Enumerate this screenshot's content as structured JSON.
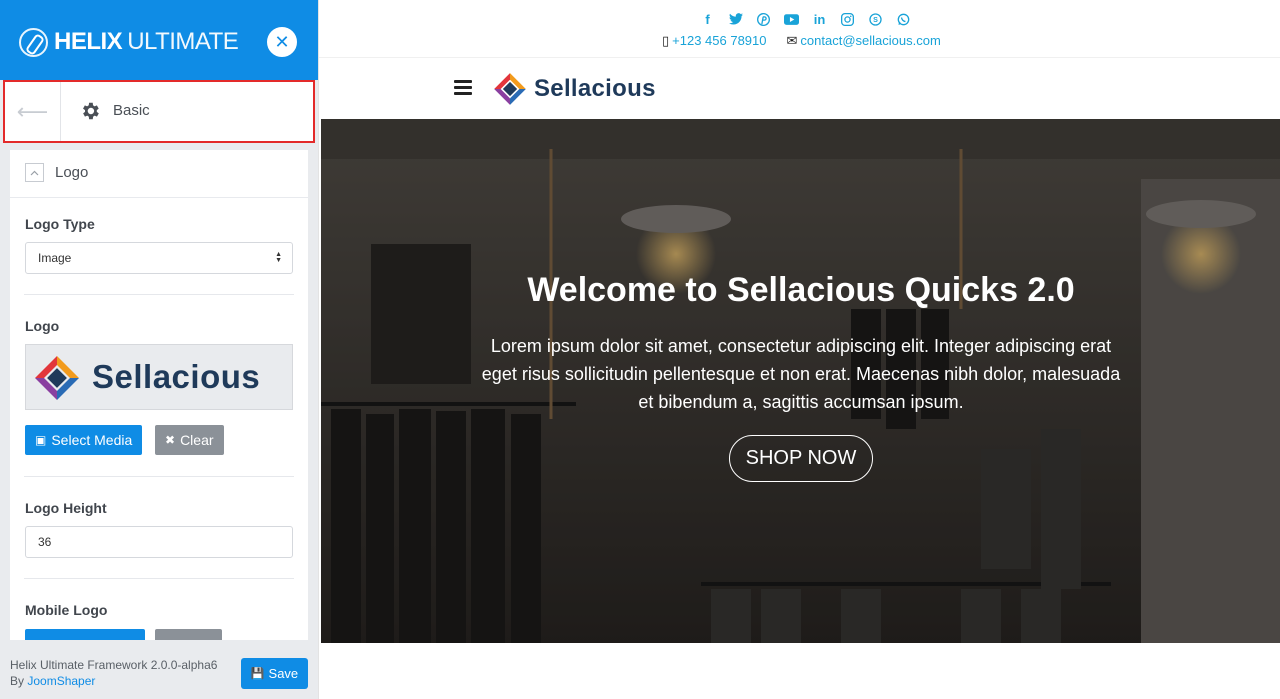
{
  "panel": {
    "brand_bold": "HELIX",
    "brand_light": "ULTIMATE",
    "section_title": "Basic",
    "group_title": "Logo",
    "fields": {
      "logo_type_label": "Logo Type",
      "logo_type_value": "Image",
      "logo_label": "Logo",
      "logo_preview_text": "Sellacious",
      "select_media": "Select Media",
      "clear": "Clear",
      "logo_height_label": "Logo Height",
      "logo_height_value": "36",
      "mobile_logo_label": "Mobile Logo"
    },
    "footer": {
      "version": "Helix Ultimate Framework 2.0.0-alpha6",
      "by": "By",
      "author": "JoomShaper",
      "save": "Save"
    }
  },
  "site": {
    "social_icons": [
      "facebook-icon",
      "twitter-icon",
      "pinterest-icon",
      "youtube-icon",
      "linkedin-icon",
      "instagram-icon",
      "skype-icon",
      "whatsapp-icon"
    ],
    "phone": "+123 456 78910",
    "email": "contact@sellacious.com",
    "logo_text": "Sellacious",
    "hero": {
      "title": "Welcome to Sellacious Quicks 2.0",
      "text": "Lorem ipsum dolor sit amet, consectetur adipiscing elit. Integer adipiscing erat eget risus sollicitudin pellentesque et non erat. Maecenas nibh dolor, malesuada et bibendum a, sagittis accumsan ipsum.",
      "button": "SHOP NOW"
    }
  },
  "colors": {
    "accent": "#0f8ce5",
    "social": "#19a3d8",
    "highlight_border": "#e32a2a"
  }
}
